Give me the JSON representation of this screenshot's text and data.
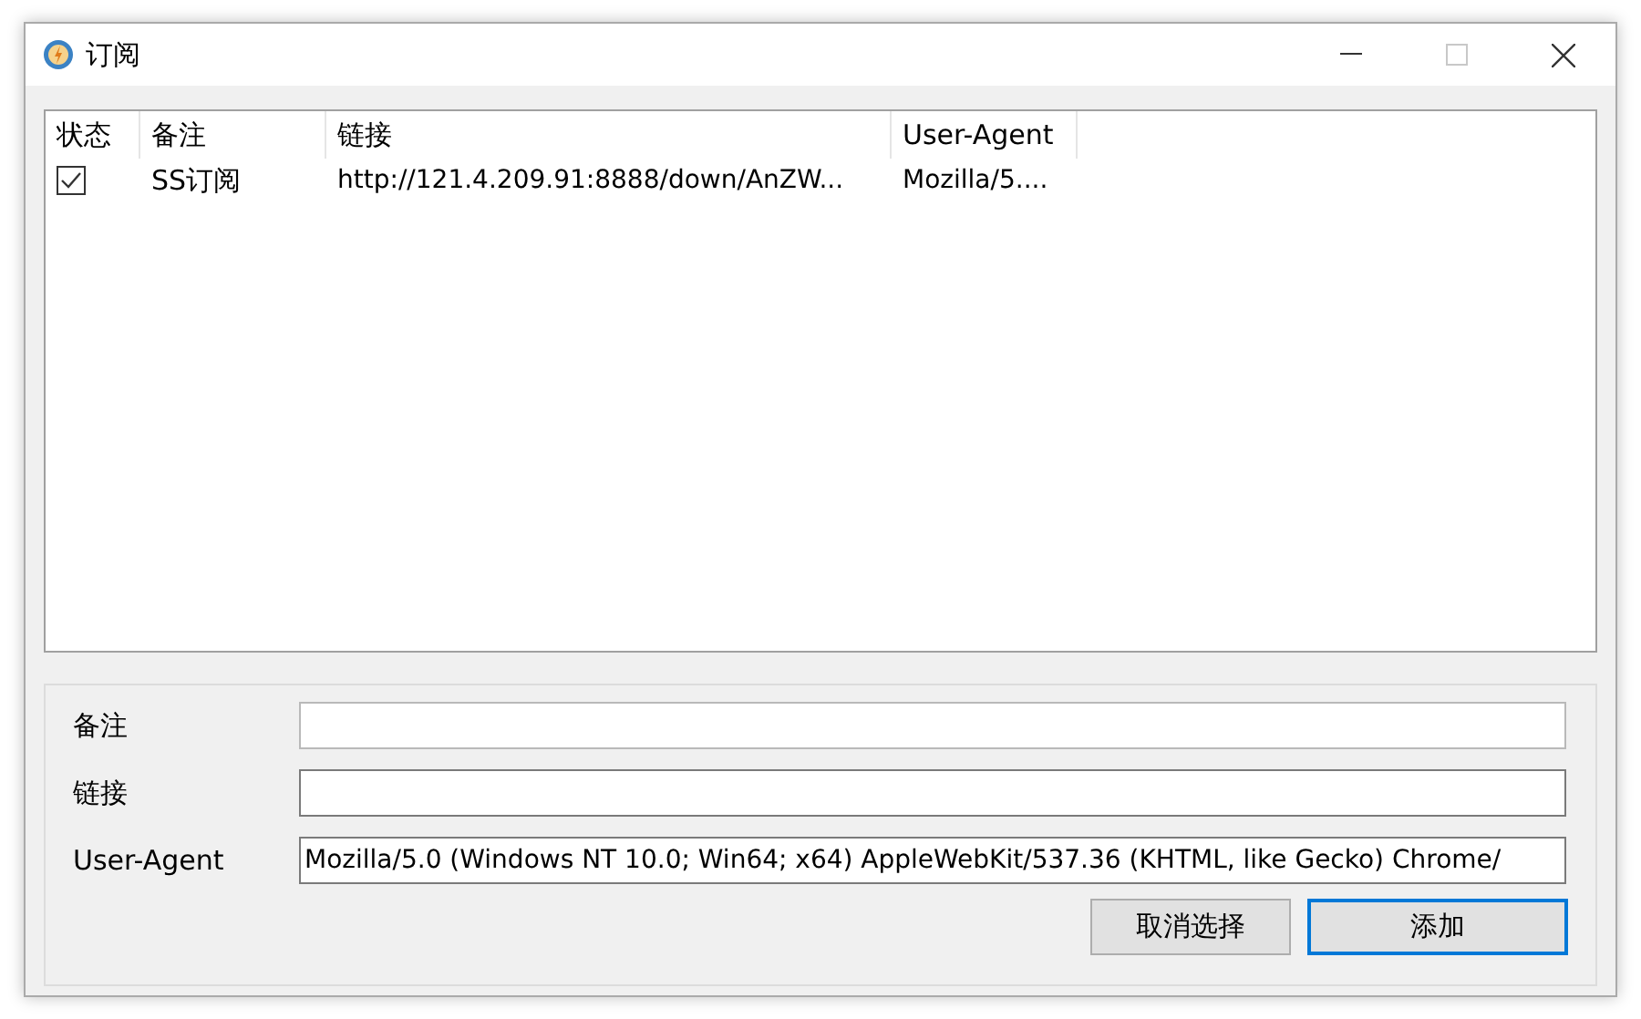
{
  "window": {
    "title": "订阅",
    "maximize_disabled": true
  },
  "table": {
    "columns": [
      "状态",
      "备注",
      "链接",
      "User-Agent"
    ],
    "rows": [
      {
        "checked": true,
        "note": "SS订阅",
        "url": "http://121.4.209.91:8888/down/AnZW...",
        "user_agent": "Mozilla/5...."
      }
    ]
  },
  "form": {
    "fields": [
      {
        "label": "备注",
        "focused": false
      },
      {
        "label": "链接",
        "focused": true
      },
      {
        "label": "User-Agent",
        "value": "Mozilla/5.0 (Windows NT 10.0; Win64; x64) AppleWebKit/537.36 (KHTML, like Gecko) Chrome/",
        "focused": true
      }
    ]
  },
  "buttons": [
    {
      "label": "取消选择",
      "default": false
    },
    {
      "label": "添加",
      "default": true
    }
  ]
}
